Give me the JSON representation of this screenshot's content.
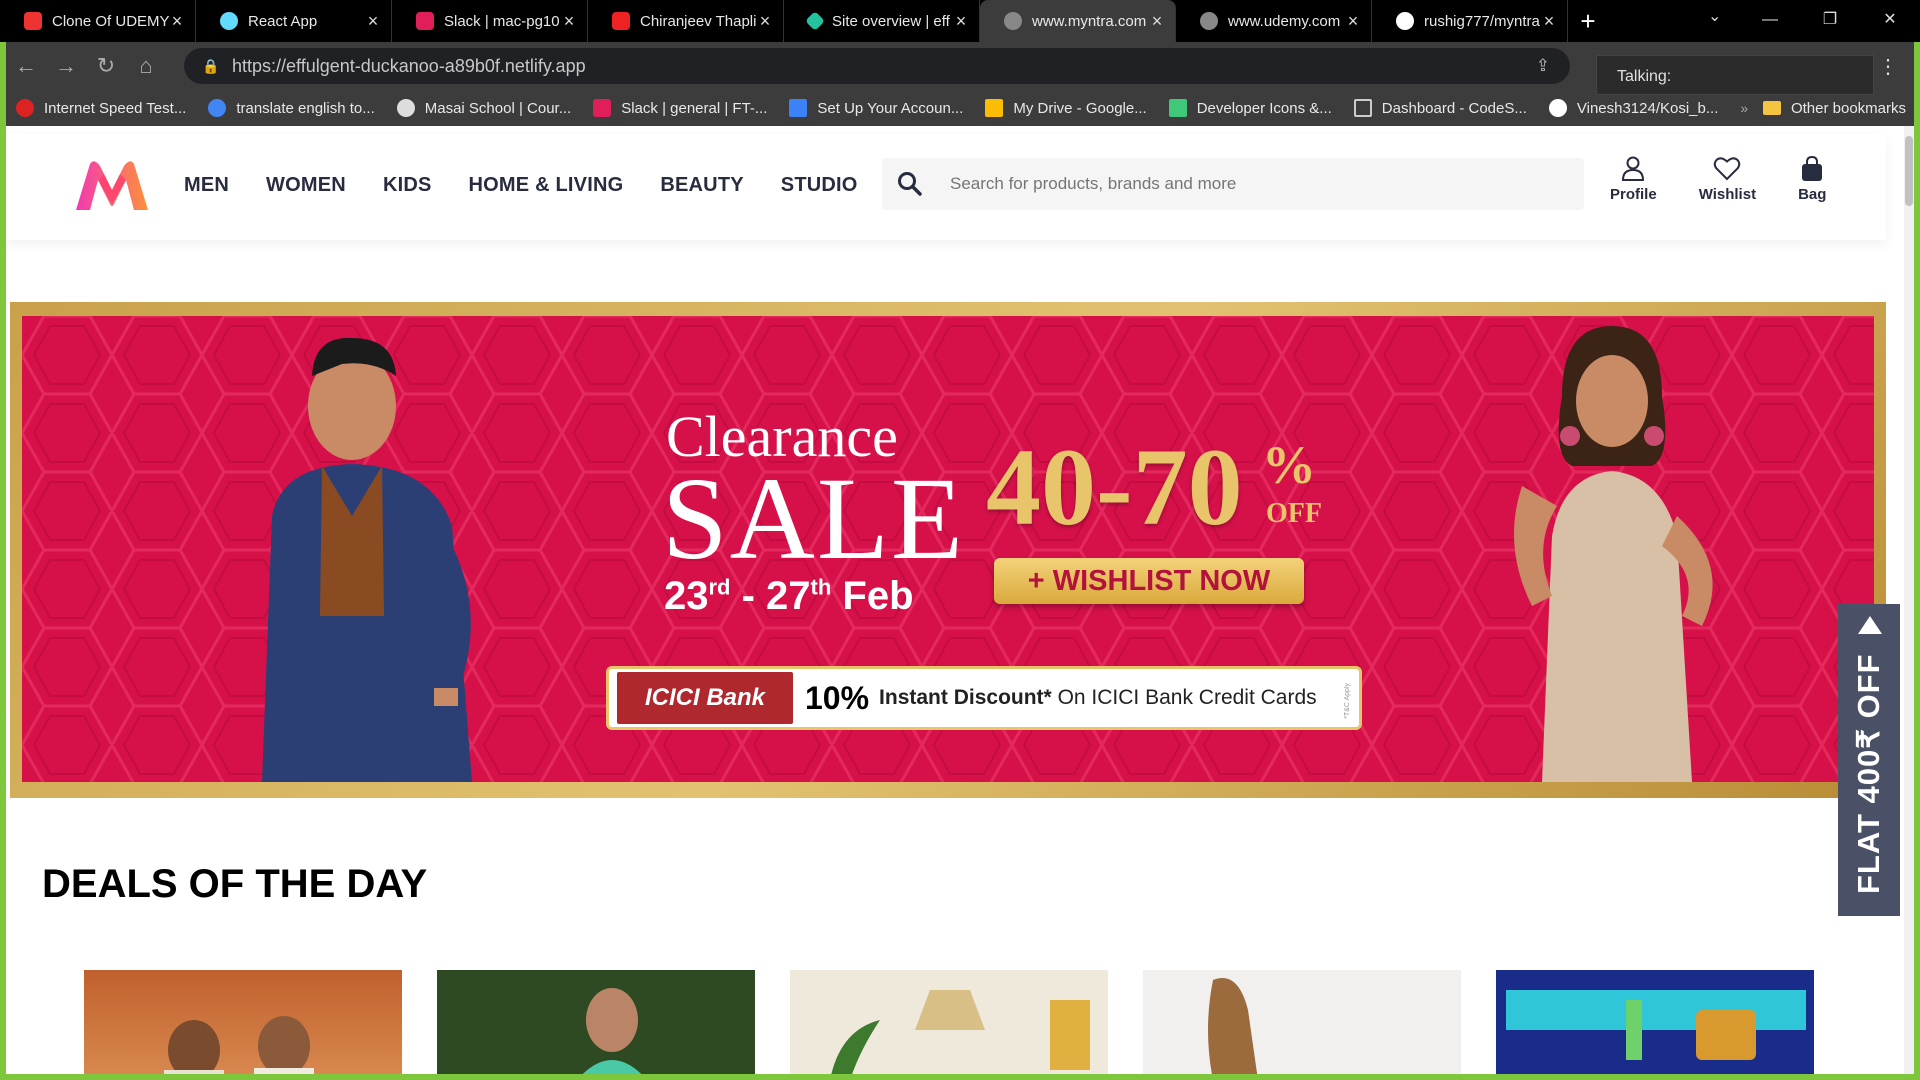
{
  "browser": {
    "tabs": [
      {
        "title": "Clone Of UDEMY",
        "color": "#e33"
      },
      {
        "title": "React App",
        "color": "#61dafb"
      },
      {
        "title": "Slack | mac-pg10",
        "color": "#e01e5a"
      },
      {
        "title": "Chiranjeev Thapli",
        "color": "#e22"
      },
      {
        "title": "Site overview | eff",
        "color": "#25c2a0"
      },
      {
        "title": "www.myntra.com",
        "color": "#888"
      },
      {
        "title": "www.udemy.com",
        "color": "#888"
      },
      {
        "title": "rushig777/myntra",
        "color": "#fff"
      }
    ],
    "url": "https://effulgent-duckanoo-a89b0f.netlify.app",
    "talking_label": "Talking:",
    "bookmarks": [
      {
        "label": "Internet Speed Test...",
        "color": "#d22"
      },
      {
        "label": "translate english to...",
        "color": "#4285f4"
      },
      {
        "label": "Masai School | Cour...",
        "color": "#ddd"
      },
      {
        "label": "Slack | general | FT-...",
        "color": "#e01e5a"
      },
      {
        "label": "Set Up Your Accoun...",
        "color": "#3b82f6"
      },
      {
        "label": "My Drive - Google...",
        "color": "#fbbc04"
      },
      {
        "label": "Developer Icons &...",
        "color": "#3fc87a"
      },
      {
        "label": "Dashboard - CodeS...",
        "color": "#ccc"
      },
      {
        "label": "Vinesh3124/Kosi_b...",
        "color": "#fff"
      }
    ],
    "bookmarks_more": "»",
    "other_bookmarks": "Other bookmarks"
  },
  "header": {
    "nav": [
      "MEN",
      "WOMEN",
      "KIDS",
      "HOME & LIVING",
      "BEAUTY",
      "STUDIO"
    ],
    "search_placeholder": "Search for products, brands and more",
    "actions": [
      "Profile",
      "Wishlist",
      "Bag"
    ]
  },
  "banner": {
    "line1": "Clearance",
    "line2": "SALE",
    "date_start_day": "23",
    "date_start_suffix": "rd",
    "date_sep": " - ",
    "date_end_day": "27",
    "date_end_suffix": "th",
    "date_month": " Feb",
    "discount": "40-70",
    "percent_sign": "%",
    "off": "OFF",
    "cta": "+ WISHLIST NOW",
    "bank_name": "ICICI Bank",
    "bank_percent": "10%",
    "bank_bold": "Instant Discount*",
    "bank_rest": " On ICICI Bank Credit Cards",
    "tnc": "*T&C Apply"
  },
  "deals": {
    "title": "DEALS OF THE DAY"
  },
  "side_offer": {
    "text": "FLAT 400₹ OFF"
  },
  "colors": {
    "brand_pink": "#ff3f6c",
    "brand_orange": "#f16565",
    "banner_red": "#d6114a",
    "gold": "#e8c46a",
    "frame_green": "#7ec63c"
  }
}
